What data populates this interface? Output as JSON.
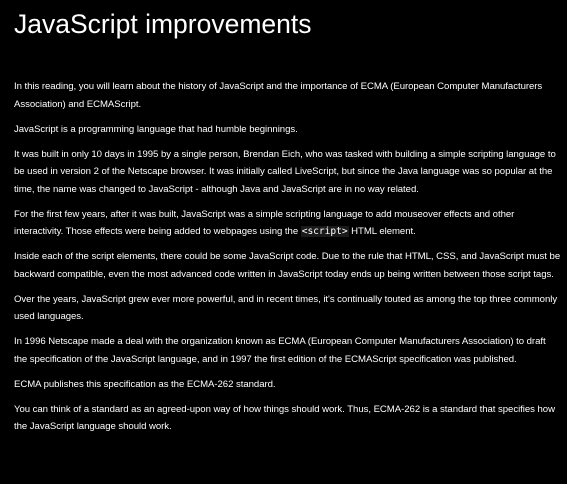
{
  "page": {
    "title": "JavaScript improvements",
    "background_color": "#000000",
    "text_color": "#ffffff"
  },
  "paragraphs": {
    "p1": "In this reading, you will learn about the history of JavaScript and the importance of ECMA (European Computer Manufacturers Association) and ECMAScript.",
    "p2": "JavaScript is a programming language that had humble beginnings.",
    "p3": "It was built in only 10 days in 1995 by a single person, Brendan Eich, who was tasked with building a simple scripting language to be used in version 2 of the Netscape browser. It was initially called LiveScript, but since the Java language was so popular at the time, the name was changed to JavaScript - although Java and JavaScript are in no way related.",
    "p4_before": "For the first few years, after it was built, JavaScript was a simple scripting language to add mouseover effects and other interactivity. Those effects were being added to webpages using the ",
    "p4_code": "<script>",
    "p4_after": " HTML element.",
    "p5": "Inside each of the script elements, there could be some JavaScript code. Due to the rule that HTML, CSS, and JavaScript must be backward compatible, even the most advanced code written in JavaScript today ends up being written between those script tags.",
    "p6": "Over the years, JavaScript grew ever more powerful, and in recent times, it's continually touted as among the top three commonly used languages.",
    "p7": "In 1996 Netscape made a deal with the organization known as ECMA (European Computer Manufacturers Association) to draft the specification of the JavaScript language, and in 1997 the first edition of the ECMAScript specification was published.",
    "p8": "ECMA publishes this specification as the ECMA-262 standard.",
    "p9": "You can think of a standard as an agreed-upon way of how things should work. Thus, ECMA-262 is a standard that specifies how the JavaScript language should work."
  }
}
